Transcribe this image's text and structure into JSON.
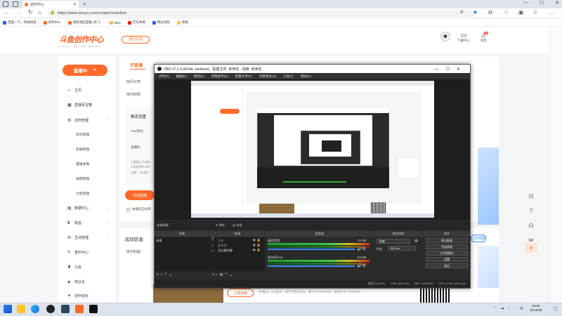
{
  "browser": {
    "tab_active": "创作中心",
    "url": "https://www.douyu.com/creator/main/live",
    "bookmarks": [
      "百度一下，你就知道",
      "创作中心",
      "海浪地区直播_热门...",
      "links",
      "京东商城",
      "网址导航",
      "链接"
    ]
  },
  "header": {
    "logo": "斗鱼创作中心",
    "logo_sub": "DOUYU CREATOR CENTER",
    "back_button": "返回主站",
    "icons": [
      {
        "label": "下载中心"
      },
      {
        "label": "消息",
        "badge": "99"
      }
    ]
  },
  "sidebar": {
    "live_button": "直播中",
    "items": [
      {
        "label": "主页",
        "icon": "home-icon"
      },
      {
        "label": "直播百宝箱",
        "icon": "box-icon"
      },
      {
        "label": "创作管理",
        "icon": "settings-icon",
        "expandable": true
      },
      {
        "label": "房间管理",
        "sub": true
      },
      {
        "label": "轮播管理",
        "sub": true
      },
      {
        "label": "直播录像",
        "sub": true
      },
      {
        "label": "视频管理",
        "sub": true
      },
      {
        "label": "文章管理",
        "sub": true
      },
      {
        "label": "数据中心",
        "icon": "chart-icon",
        "expandable": true
      },
      {
        "label": "收益",
        "icon": "money-icon",
        "expandable": true
      },
      {
        "label": "互动管理",
        "icon": "chat-icon",
        "expandable": true
      },
      {
        "label": "签约中心",
        "icon": "contract-icon"
      },
      {
        "label": "公会",
        "icon": "guild-icon"
      },
      {
        "label": "商业化",
        "icon": "business-icon"
      },
      {
        "label": "创作成长",
        "icon": "growth-icon"
      }
    ]
  },
  "main": {
    "tab_label": "开直播",
    "room_category_label": "房间分类",
    "room_title_label": "房间标题",
    "push_setup_label": "推流设置",
    "rtmp_label": "rtmp地址",
    "key_label": "直播码",
    "tips": [
      "1.复制上方地址",
      "2.粘贴到RTMP",
      "注意：rtmp地"
    ],
    "stop_button": "关闭直播",
    "checkbox_label": "关播后自动转",
    "room_info_title": "房间信息",
    "room_cover_label": "房间封面",
    "upload_button": "上传封面",
    "upload_hint": "支持jpg、png格式，最大不超过10M，最小尺寸575*325，建议尺寸>=896*500",
    "right_button": "立即领取"
  },
  "obs": {
    "title": "OBS 27.2.4 (64-bit, windows) - 配置文件: 未命名 - 场景: 未命名",
    "menu": [
      "文件(F)",
      "编辑(E)",
      "视图(V)",
      "停靠部件(D)",
      "配置文件(P)",
      "场景集合(S)",
      "工具(T)",
      "帮助(H)"
    ],
    "source_bar_left": "未选择源",
    "source_bar_props": "属性",
    "source_bar_filters": "滤镜",
    "docks": {
      "scenes": {
        "title": "场景",
        "items": [
          "场景"
        ]
      },
      "sources": {
        "title": "来源",
        "items": [
          "文本",
          "颜色源",
          "显示器采集"
        ]
      },
      "mixer": {
        "title": "混音器",
        "channels": [
          {
            "name": "桌面音频",
            "db": "0.0 dB"
          },
          {
            "name": "麦克风/Aux",
            "db": "0.0 dB"
          }
        ]
      },
      "transitions": {
        "title": "转场特效",
        "mode": "渐变",
        "duration_label": "时长",
        "duration": "300 ms"
      },
      "controls": {
        "title": "控件",
        "buttons": [
          "停止推流",
          "开始录制",
          "工作室模式",
          "设置",
          "退出"
        ]
      }
    },
    "status": {
      "live": "LIVE: 00:01:05",
      "rec": "REC: 00:00:00",
      "cpu": "CPU: 2.5%, 30.00 fps",
      "drop": "丢帧 0 (0.0%)"
    }
  },
  "taskbar": {
    "time": "18:05",
    "date": "2024/3/6",
    "lang": "中"
  }
}
